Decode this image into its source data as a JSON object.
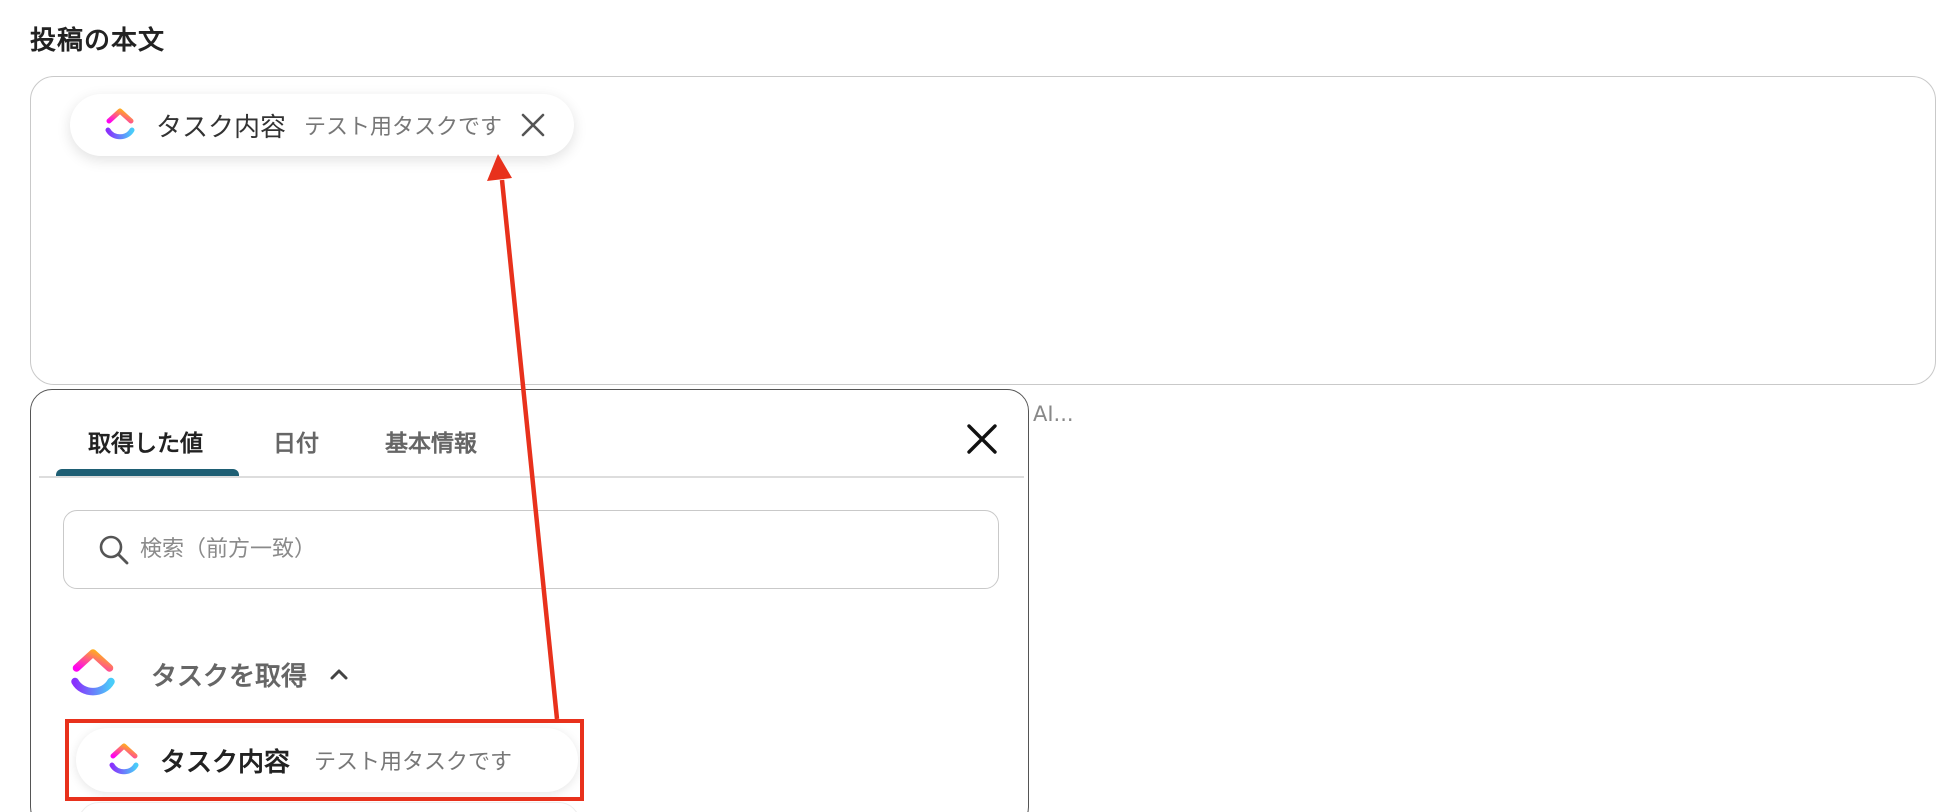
{
  "post_body": {
    "title": "投稿の本文",
    "chip": {
      "label": "タスク内容",
      "value": "テスト用タスクです",
      "icon": "clickup-logo-icon",
      "close_icon": "close-icon"
    }
  },
  "side_text": "AI...",
  "picker": {
    "tabs": [
      {
        "label": "取得した値",
        "active": true
      },
      {
        "label": "日付",
        "active": false
      },
      {
        "label": "基本情報",
        "active": false
      }
    ],
    "close_icon": "close-icon",
    "search": {
      "placeholder": "検索（前方一致）",
      "value": "",
      "icon": "search-icon"
    },
    "group": {
      "title": "タスクを取得",
      "icon": "clickup-logo-icon",
      "expanded": true,
      "chevron_icon": "chevron-up-icon"
    },
    "items": [
      {
        "label": "タスク内容",
        "value": "テスト用タスクです",
        "icon": "clickup-logo-icon"
      }
    ]
  },
  "annotation": {
    "color": "#e8311c",
    "arrow_icon": "red-arrow"
  },
  "colors": {
    "tab_indicator": "#1e5f74",
    "brand_gradient": [
      "#ff02f0",
      "#ffc800",
      "#8930fd",
      "#49ccf9"
    ]
  }
}
